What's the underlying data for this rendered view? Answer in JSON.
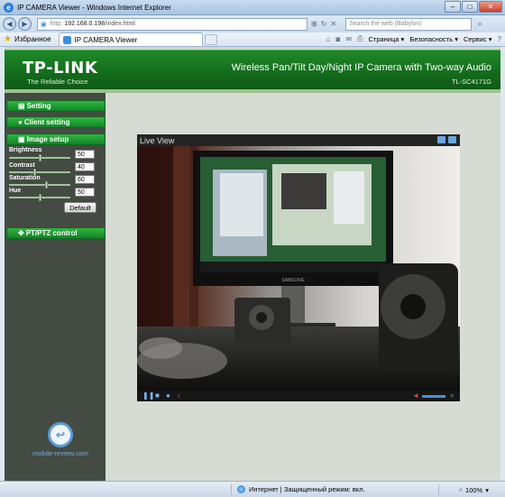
{
  "window": {
    "title": "IP CAMERA Viewer - Windows Internet Explorer"
  },
  "address": {
    "protocol": "http:",
    "host": "192.168.0.198",
    "path": "/index.html"
  },
  "search": {
    "placeholder": "Search the web (Babylon)"
  },
  "favorites": {
    "label": "Избранное"
  },
  "tab": {
    "title": "IP CAMERA Viewer"
  },
  "command_bar": {
    "page": "Страница ▾",
    "safety": "Безопасность ▾",
    "service": "Сервис ▾"
  },
  "banner": {
    "logo": "TP-LINK",
    "tagline": "The Reliable Choice",
    "title": "Wireless Pan/Tilt Day/Night IP Camera with Two-way Audio",
    "model": "TL-SC4171G"
  },
  "sidebar": {
    "setting": "Setting",
    "client_setting": "Client setting",
    "image_setup": "Image setup",
    "ptz_control": "PT/PTZ control",
    "params": [
      {
        "label": "Brightness",
        "value": "50",
        "level": 0.5
      },
      {
        "label": "Contrast",
        "value": "40",
        "level": 0.4
      },
      {
        "label": "Saturation",
        "value": "60",
        "level": 0.6
      },
      {
        "label": "Hue",
        "value": "50",
        "level": 0.5
      }
    ],
    "default_button": "Default"
  },
  "live_view": {
    "title": "Live View",
    "monitor_brand": "SAMSUNG"
  },
  "watermark": {
    "text": "mobile-review.com"
  },
  "status": {
    "zone": "Интернет | Защищенный режим: вкл.",
    "zoom": "100%"
  },
  "colors": {
    "brand_green": "#14822b",
    "banner_green": "#136b1b",
    "sidebar_bg": "#434b42",
    "accent_blue": "#79b3ee"
  }
}
